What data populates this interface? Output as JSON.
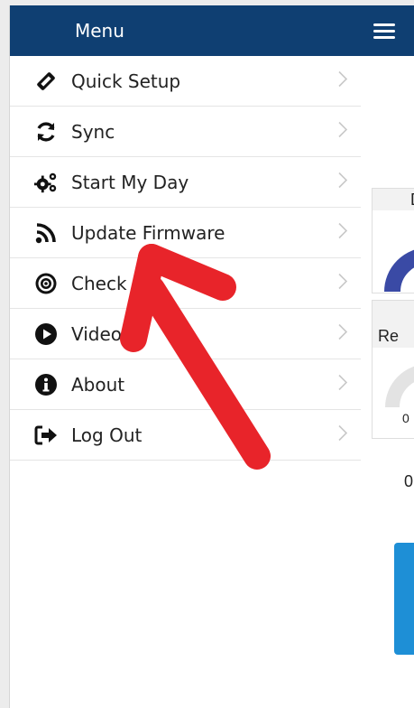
{
  "drawer": {
    "title": "Menu",
    "items": [
      {
        "label": "Quick Setup",
        "icon": "ticket-icon"
      },
      {
        "label": "Sync",
        "icon": "sync-icon"
      },
      {
        "label": "Start My Day",
        "icon": "cogs-icon"
      },
      {
        "label": "Update Firmware",
        "icon": "rss-icon"
      },
      {
        "label": "Check P",
        "icon": "bullseye-icon"
      },
      {
        "label": "Videos",
        "icon": "play-circle-icon"
      },
      {
        "label": "About",
        "icon": "info-circle-icon"
      },
      {
        "label": "Log Out",
        "icon": "sign-out-icon"
      }
    ]
  },
  "background": {
    "card1_head": "D",
    "card2_head": "Re",
    "partial_number": "0",
    "partial_number_2": "0"
  },
  "colors": {
    "header": "#0f3f72",
    "accent_blue": "#1e8fd6",
    "arrow_red": "#e8242a"
  }
}
